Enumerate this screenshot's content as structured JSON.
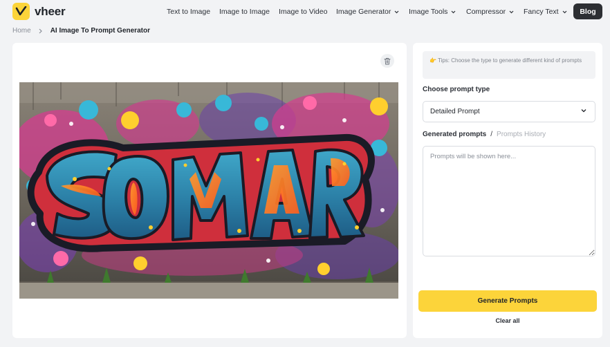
{
  "brand": {
    "name": "vheer",
    "accent": "#fcd43a"
  },
  "nav": {
    "items": [
      {
        "label": "Text to Image",
        "dropdown": false
      },
      {
        "label": "Image to Image",
        "dropdown": false
      },
      {
        "label": "Image to Video",
        "dropdown": false
      },
      {
        "label": "Image Generator",
        "dropdown": true
      },
      {
        "label": "Image Tools",
        "dropdown": true
      },
      {
        "label": "Compressor",
        "dropdown": true
      },
      {
        "label": "Fancy Text",
        "dropdown": true
      }
    ],
    "blog_label": "Blog"
  },
  "breadcrumb": {
    "home": "Home",
    "current": "AI Image To Prompt Generator"
  },
  "preview": {
    "delete_icon": "trash-icon",
    "image": "colorful-graffiti-wall"
  },
  "sidebar": {
    "tips": "Tips: Choose the type to generate different kind of prompts",
    "prompt_type_label": "Choose prompt type",
    "prompt_type_value": "Detailed Prompt",
    "generated_label": "Generated prompts",
    "history_label": "Prompts History",
    "output_placeholder": "Prompts will be shown here...",
    "generate_label": "Generate Prompts",
    "clear_label": "Clear all"
  }
}
